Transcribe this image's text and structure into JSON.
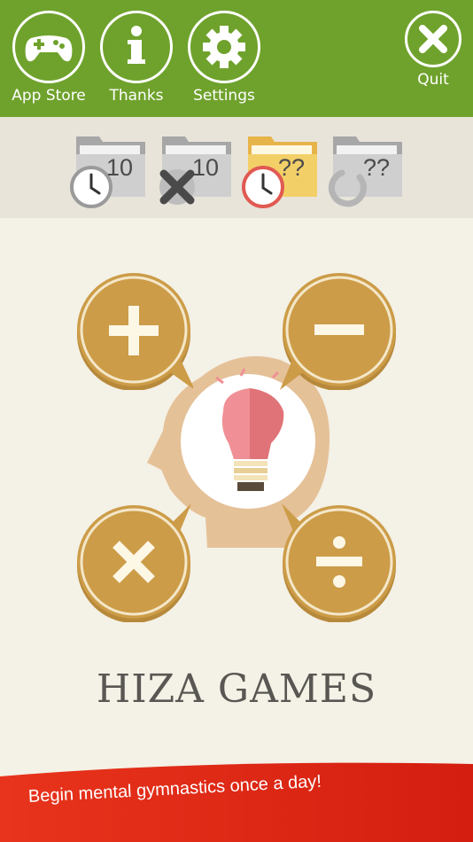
{
  "header": {
    "buttons": [
      {
        "label": "App Store",
        "icon": "gamepad-icon"
      },
      {
        "label": "Thanks",
        "icon": "info-icon"
      },
      {
        "label": "Settings",
        "icon": "gear-icon"
      }
    ],
    "quit_label": "Quit",
    "colors": {
      "bar": "#6fa22c",
      "foreground": "#ffffff"
    }
  },
  "modes": [
    {
      "value": "10",
      "icon": "clock-icon",
      "color": "gray"
    },
    {
      "value": "10",
      "icon": "cross-icon",
      "color": "gray"
    },
    {
      "value": "??",
      "icon": "clock-icon",
      "color": "yellow"
    },
    {
      "value": "??",
      "icon": "refresh-icon",
      "color": "gray"
    }
  ],
  "operations": [
    "plus",
    "minus",
    "multiply",
    "divide"
  ],
  "brand": "HIZA GAMES",
  "banner": {
    "text": "Begin mental gymnastics once a day!",
    "color": "#e8341c"
  }
}
